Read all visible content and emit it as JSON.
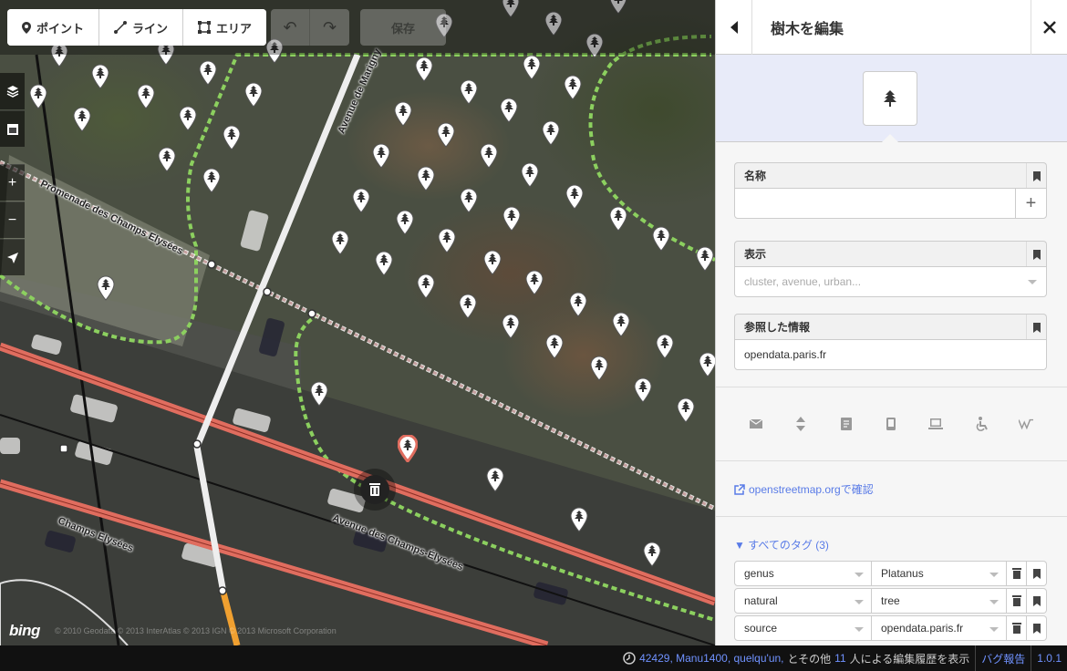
{
  "toolbar": {
    "modes": [
      {
        "label": "ポイント",
        "icon": "point-icon"
      },
      {
        "label": "ライン",
        "icon": "line-icon"
      },
      {
        "label": "エリア",
        "icon": "area-icon"
      }
    ],
    "undo_icon": "undo-icon",
    "redo_icon": "redo-icon",
    "save_label": "保存"
  },
  "map": {
    "streets": {
      "avenue_de_marigny": "Avenue de Marigny",
      "promenade": "Promenade des Champs Elysées",
      "avenue_champs": "Avenue des Champs-Élysées",
      "champs": "Champs Elysées"
    },
    "bing_logo": "bing",
    "attribution": "© 2010 Geodata © 2013 InterAtlas © 2013 IGN © 2013 Microsoft Corporation"
  },
  "sidebar": {
    "title": "樹木を編集",
    "fields": {
      "name_label": "名称",
      "name_value": "",
      "display_label": "表示",
      "display_placeholder": "cluster, avenue, urban...",
      "source_label": "参照した情報",
      "source_value": "opendata.paris.fr"
    },
    "more_field_icons": [
      "email-icon",
      "elevation-icon",
      "note-icon",
      "phone-icon",
      "website-icon",
      "wheelchair-icon",
      "wikipedia-icon"
    ],
    "view_osm": "openstreetmap.orgで確認",
    "all_tags": "▼ すべてのタグ (3)",
    "tags": [
      {
        "key": "genus",
        "value": "Platanus"
      },
      {
        "key": "natural",
        "value": "tree"
      },
      {
        "key": "source",
        "value": "opendata.paris.fr"
      }
    ]
  },
  "footer": {
    "users": "42429, Manu1400, quelqu'un,",
    "history_mid": "とその他",
    "count": "11",
    "history_end": "人による編集履歴を表示",
    "bug_report": "バグ報告",
    "version": "1.0.1"
  },
  "colors": {
    "accent": "#597be7",
    "footer_link": "#7092ff",
    "primary_road": "#e06d5f",
    "area_outline": "#8cd05f"
  }
}
